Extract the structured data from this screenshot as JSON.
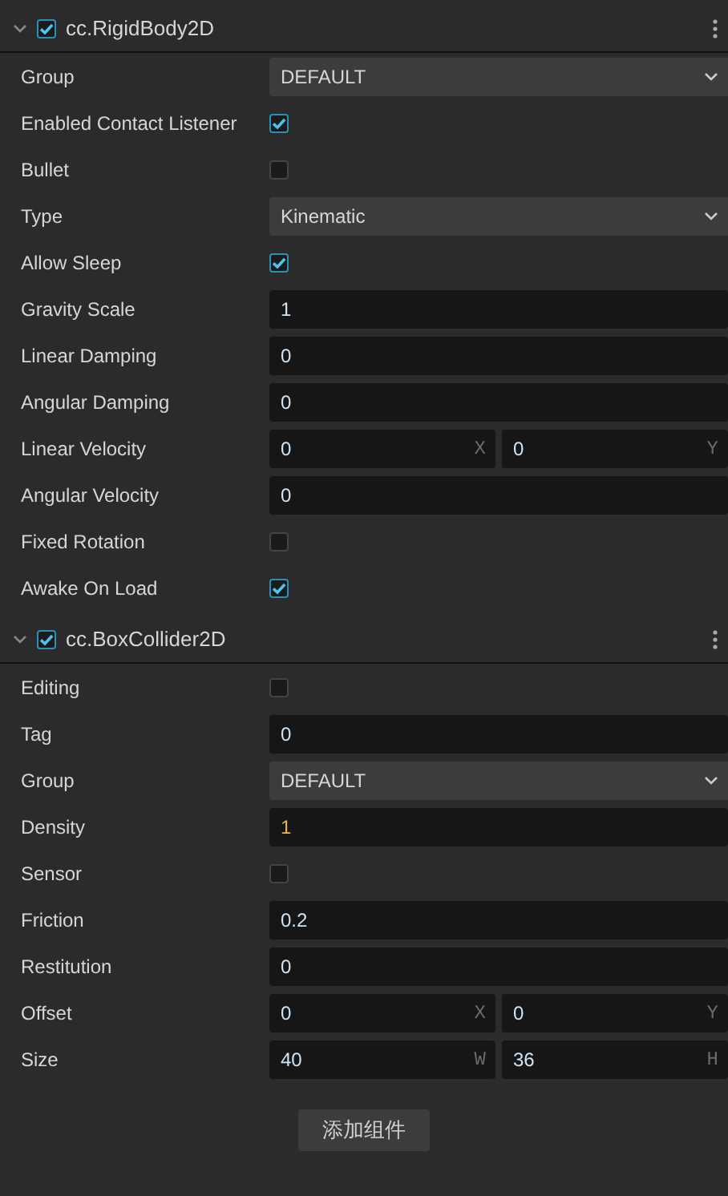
{
  "components": [
    {
      "title": "cc.RigidBody2D",
      "enabled": true,
      "expanded": true,
      "properties": [
        {
          "label": "Group",
          "kind": "select",
          "value": "DEFAULT"
        },
        {
          "label": "Enabled Contact Listener",
          "kind": "checkbox",
          "checked": true
        },
        {
          "label": "Bullet",
          "kind": "checkbox",
          "checked": false
        },
        {
          "label": "Type",
          "kind": "select",
          "value": "Kinematic"
        },
        {
          "label": "Allow Sleep",
          "kind": "checkbox",
          "checked": true
        },
        {
          "label": "Gravity Scale",
          "kind": "number",
          "value": "1",
          "modified": false
        },
        {
          "label": "Linear Damping",
          "kind": "number",
          "value": "0",
          "modified": false
        },
        {
          "label": "Angular Damping",
          "kind": "number",
          "value": "0",
          "modified": false
        },
        {
          "label": "Linear Velocity",
          "kind": "vector",
          "fields": [
            {
              "value": "0",
              "axis": "X"
            },
            {
              "value": "0",
              "axis": "Y"
            }
          ]
        },
        {
          "label": "Angular Velocity",
          "kind": "number",
          "value": "0",
          "modified": false
        },
        {
          "label": "Fixed Rotation",
          "kind": "checkbox",
          "checked": false
        },
        {
          "label": "Awake On Load",
          "kind": "checkbox",
          "checked": true
        }
      ]
    },
    {
      "title": "cc.BoxCollider2D",
      "enabled": true,
      "expanded": true,
      "properties": [
        {
          "label": "Editing",
          "kind": "checkbox",
          "checked": false
        },
        {
          "label": "Tag",
          "kind": "number",
          "value": "0",
          "modified": false
        },
        {
          "label": "Group",
          "kind": "select",
          "value": "DEFAULT"
        },
        {
          "label": "Density",
          "kind": "number",
          "value": "1",
          "modified": true
        },
        {
          "label": "Sensor",
          "kind": "checkbox",
          "checked": false
        },
        {
          "label": "Friction",
          "kind": "number",
          "value": "0.2",
          "modified": false
        },
        {
          "label": "Restitution",
          "kind": "number",
          "value": "0",
          "modified": false
        },
        {
          "label": "Offset",
          "kind": "vector",
          "fields": [
            {
              "value": "0",
              "axis": "X"
            },
            {
              "value": "0",
              "axis": "Y"
            }
          ]
        },
        {
          "label": "Size",
          "kind": "vector",
          "fields": [
            {
              "value": "40",
              "axis": "W"
            },
            {
              "value": "36",
              "axis": "H"
            }
          ]
        }
      ]
    }
  ],
  "add_button": "添加组件"
}
